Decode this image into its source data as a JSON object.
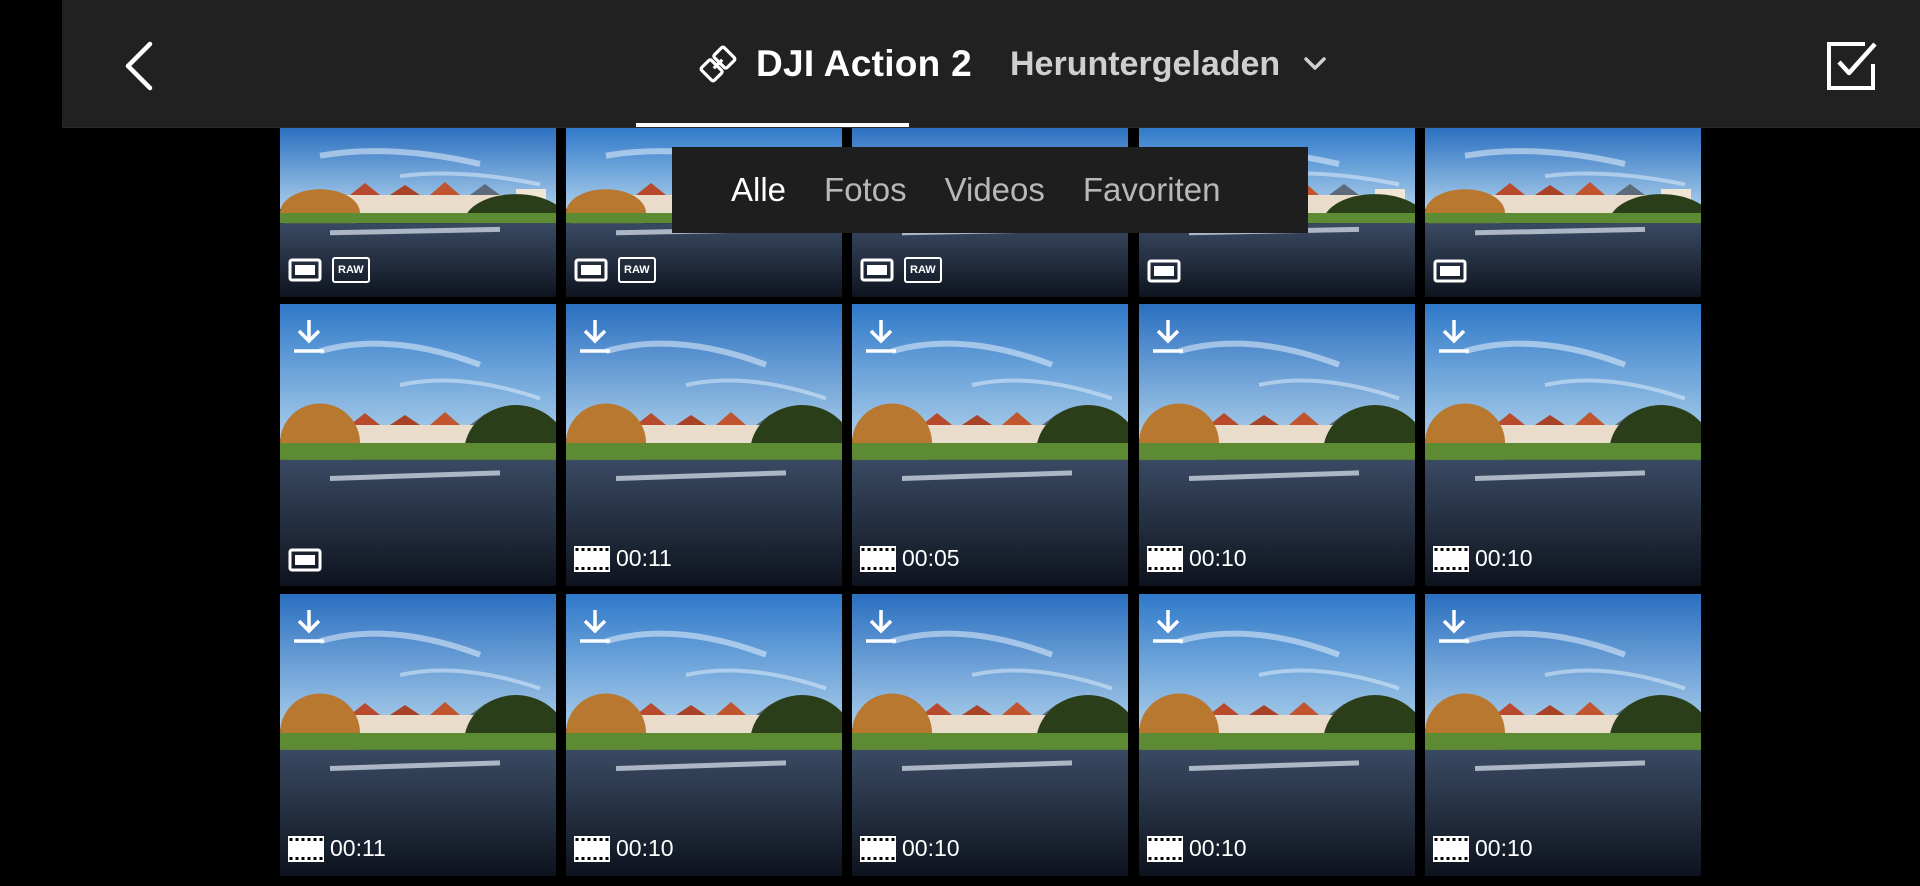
{
  "header": {
    "back_icon": "chevron-left-icon",
    "device_icon": "camera-link-icon",
    "device_name": "DJI Action 2",
    "filter_label": "Heruntergeladen",
    "filter_icon": "chevron-down-icon",
    "select_icon": "checkbox-checked-icon"
  },
  "tabs": [
    {
      "label": "Alle",
      "active": true
    },
    {
      "label": "Fotos",
      "active": false
    },
    {
      "label": "Videos",
      "active": false
    },
    {
      "label": "Favoriten",
      "active": false
    }
  ],
  "media": [
    {
      "type": "photo",
      "raw": true,
      "raw_label": "RAW",
      "downloaded": false,
      "duration": ""
    },
    {
      "type": "photo",
      "raw": true,
      "raw_label": "RAW",
      "downloaded": false,
      "duration": ""
    },
    {
      "type": "photo",
      "raw": true,
      "raw_label": "RAW",
      "downloaded": false,
      "duration": ""
    },
    {
      "type": "photo",
      "raw": false,
      "raw_label": "",
      "downloaded": false,
      "duration": ""
    },
    {
      "type": "photo",
      "raw": false,
      "raw_label": "",
      "downloaded": false,
      "duration": ""
    },
    {
      "type": "photo",
      "raw": false,
      "raw_label": "",
      "downloaded": true,
      "duration": ""
    },
    {
      "type": "video",
      "raw": false,
      "raw_label": "",
      "downloaded": true,
      "duration": "00:11"
    },
    {
      "type": "video",
      "raw": false,
      "raw_label": "",
      "downloaded": true,
      "duration": "00:05"
    },
    {
      "type": "video",
      "raw": false,
      "raw_label": "",
      "downloaded": true,
      "duration": "00:10"
    },
    {
      "type": "video",
      "raw": false,
      "raw_label": "",
      "downloaded": true,
      "duration": "00:10"
    },
    {
      "type": "video",
      "raw": false,
      "raw_label": "",
      "downloaded": true,
      "duration": "00:11"
    },
    {
      "type": "video",
      "raw": false,
      "raw_label": "",
      "downloaded": true,
      "duration": "00:10"
    },
    {
      "type": "video",
      "raw": false,
      "raw_label": "",
      "downloaded": true,
      "duration": "00:10"
    },
    {
      "type": "video",
      "raw": false,
      "raw_label": "",
      "downloaded": true,
      "duration": "00:10"
    },
    {
      "type": "video",
      "raw": false,
      "raw_label": "",
      "downloaded": true,
      "duration": "00:10"
    }
  ],
  "colors": {
    "bar_bg": "#212121",
    "page_bg": "#000000",
    "tab_active": "#ffffff",
    "tab_inactive": "#b8b8b8"
  }
}
